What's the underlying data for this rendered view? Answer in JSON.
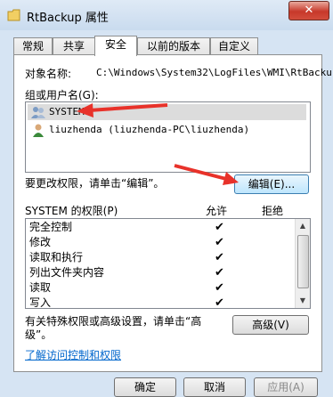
{
  "window": {
    "title": "RtBackup 属性",
    "close_label": "✕"
  },
  "tabs": [
    "常规",
    "共享",
    "安全",
    "以前的版本",
    "自定义"
  ],
  "object_name": {
    "label": "对象名称:",
    "value": "C:\\Windows\\System32\\LogFiles\\WMI\\RtBacku"
  },
  "groups": {
    "label": "组或用户名(G):",
    "items": [
      "SYSTEM",
      "liuzhenda (liuzhenda-PC\\liuzhenda)"
    ]
  },
  "edit_prompt": "要更改权限，请单击“编辑”。",
  "edit_button": "编辑(E)...",
  "permissions": {
    "header": "SYSTEM 的权限(P)",
    "allow": "允许",
    "deny": "拒绝",
    "check_glyph": "✔",
    "rows": [
      "完全控制",
      "修改",
      "读取和执行",
      "列出文件夹内容",
      "读取",
      "写入"
    ]
  },
  "advanced_prompt": [
    "有关特殊权限或高级设置，请单击“高",
    "级”。"
  ],
  "advanced_button": "高级(V)",
  "help_link": "了解访问控制和权限",
  "buttons": {
    "ok": "确定",
    "cancel": "取消",
    "apply": "应用(A)"
  },
  "colors": {
    "arrow": "#e8322a",
    "link": "#0066cc"
  }
}
